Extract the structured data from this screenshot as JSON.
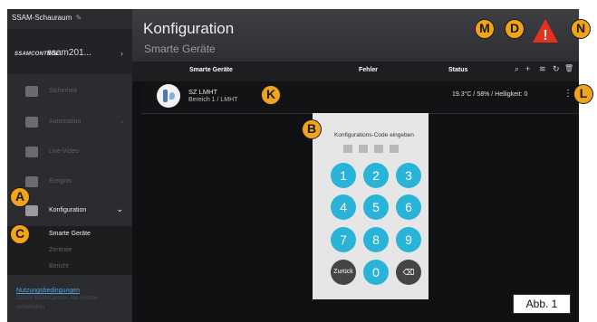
{
  "sidebar": {
    "site_name": "SSAM-Schauraum",
    "edit_icon": "edit-icon",
    "logo_text": "SSAMCONTROL",
    "system_name": "ssam201...",
    "nav": [
      {
        "label": "Sicherheit",
        "icon": "shield-icon",
        "arrow": ""
      },
      {
        "label": "Automation",
        "icon": "sliders-icon",
        "arrow": "›"
      },
      {
        "label": "Live-Video",
        "icon": "camera-icon",
        "arrow": ""
      },
      {
        "label": "Ereignis",
        "icon": "list-icon",
        "arrow": ""
      },
      {
        "label": "Konfiguration",
        "icon": "gear-icon",
        "arrow": "⌄"
      }
    ],
    "sub": [
      {
        "label": "Smarte Geräte"
      },
      {
        "label": "Zentrale"
      },
      {
        "label": "Bericht"
      }
    ],
    "footer": {
      "terms": "Nutzungsbedingungen",
      "copyright_1": "©2018 SSAMControl. Alle Rechte",
      "copyright_2": "vorbehalten"
    }
  },
  "main": {
    "title": "Konfiguration",
    "subtitle": "Smarte Geräte",
    "columns": {
      "device": "Smarte Geräte",
      "error": "Fehler",
      "status": "Status"
    },
    "tools": {
      "search": "⌕",
      "add": "+",
      "wifi": "≋",
      "refresh": "↻",
      "delete": "🗑"
    },
    "device": {
      "name": "SZ LMHT",
      "location": "Bereich 1 / LMHT",
      "status": "19.3°C / 58% / Helligkeit: 0",
      "menu": "⋮"
    }
  },
  "keypad": {
    "title": "Konfigurations-Code eingeben",
    "keys": [
      "1",
      "2",
      "3",
      "4",
      "5",
      "6",
      "7",
      "8",
      "9"
    ],
    "back_label": "Zurück",
    "zero": "0",
    "delete": "⌫"
  },
  "annotations": {
    "A": "A",
    "B": "B",
    "C": "C",
    "D": "D",
    "K": "K",
    "L": "L",
    "M": "M",
    "N": "N",
    "warning": "!",
    "figure_label": "Abb. 1"
  },
  "colors": {
    "accent": "#2ab3d8",
    "badge": "#f0a31b",
    "warning": "#e6301f",
    "link": "#4da3e0"
  }
}
